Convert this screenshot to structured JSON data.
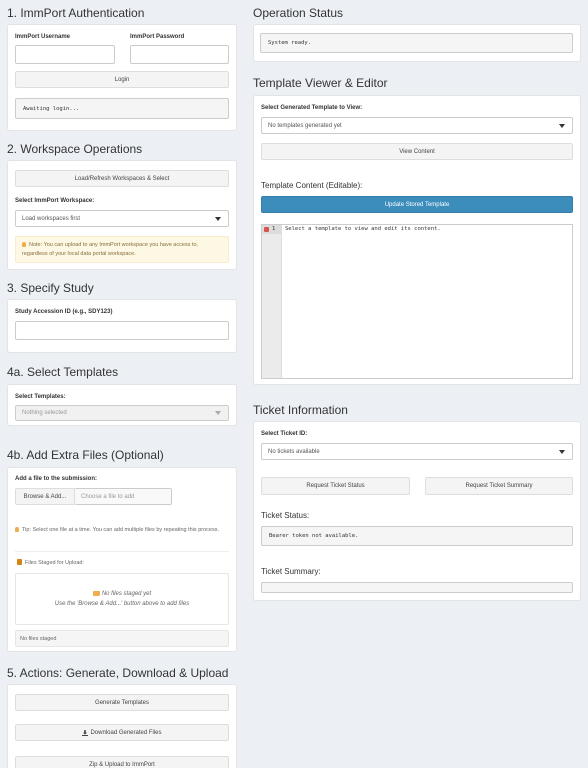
{
  "auth": {
    "title": "1. ImmPort Authentication",
    "username_label": "ImmPort Username",
    "username_value": "",
    "password_label": "ImmPort Password",
    "password_value": "",
    "login_label": "Login",
    "status": "Awaiting login..."
  },
  "workspace": {
    "title": "2. Workspace Operations",
    "load_label": "Load/Refresh Workspaces & Select",
    "select_label": "Select ImmPort Workspace:",
    "select_value": "Load workspaces first",
    "note": "Note: You can upload to any ImmPort workspace you have access to, regardless of your local data portal workspace."
  },
  "study": {
    "title": "3. Specify Study",
    "label": "Study Accession ID (e.g., SDY123)",
    "value": ""
  },
  "templates": {
    "title": "4a. Select Templates",
    "label": "Select Templates:",
    "value": "Nothing selected"
  },
  "files": {
    "title": "4b. Add Extra Files (Optional)",
    "label": "Add a file to the submission:",
    "browse_label": "Browse & Add...",
    "file_placeholder": "Choose a file to add",
    "tip": "Tip: Select one file at a time. You can add multiple files by repeating this process.",
    "staged_label": "Files Staged for Upload:",
    "empty_title": "No files staged yet",
    "empty_hint": "Use the 'Browse & Add...' button above to add files",
    "footer": "No files staged"
  },
  "actions": {
    "title": "5. Actions: Generate, Download & Upload",
    "generate_label": "Generate Templates",
    "download_label": "Download Generated Files",
    "upload_label": "Zip & Upload to ImmPort"
  },
  "operation": {
    "title": "Operation Status",
    "status": "System ready."
  },
  "viewer": {
    "title": "Template Viewer & Editor",
    "select_label": "Select Generated Template to View:",
    "select_value": "No templates generated yet",
    "view_label": "View Content",
    "content_label": "Template Content (Editable):",
    "update_label": "Update Stored Template",
    "line_number": "1",
    "editor_text": "Select a template to view and edit its content."
  },
  "ticket": {
    "title": "Ticket Information",
    "select_label": "Select Ticket ID:",
    "select_value": "No tickets available",
    "status_btn": "Request Ticket Status",
    "summary_btn": "Request Ticket Summary",
    "status_label": "Ticket Status:",
    "status_value": "Bearer token not available.",
    "summary_label": "Ticket Summary:",
    "summary_value": ""
  }
}
